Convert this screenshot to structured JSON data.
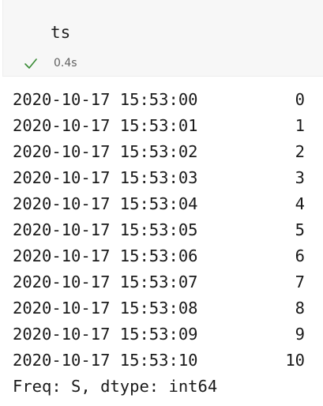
{
  "cell": {
    "code": "ts",
    "status_icon": "check-icon",
    "status_color": "#388a34",
    "exec_time": "0.4s"
  },
  "output": {
    "rows": [
      {
        "index": "2020-10-17 15:53:00",
        "value": "0"
      },
      {
        "index": "2020-10-17 15:53:01",
        "value": "1"
      },
      {
        "index": "2020-10-17 15:53:02",
        "value": "2"
      },
      {
        "index": "2020-10-17 15:53:03",
        "value": "3"
      },
      {
        "index": "2020-10-17 15:53:04",
        "value": "4"
      },
      {
        "index": "2020-10-17 15:53:05",
        "value": "5"
      },
      {
        "index": "2020-10-17 15:53:06",
        "value": "6"
      },
      {
        "index": "2020-10-17 15:53:07",
        "value": "7"
      },
      {
        "index": "2020-10-17 15:53:08",
        "value": "8"
      },
      {
        "index": "2020-10-17 15:53:09",
        "value": "9"
      },
      {
        "index": "2020-10-17 15:53:10",
        "value": "10"
      }
    ],
    "footer": "Freq: S, dtype: int64"
  }
}
